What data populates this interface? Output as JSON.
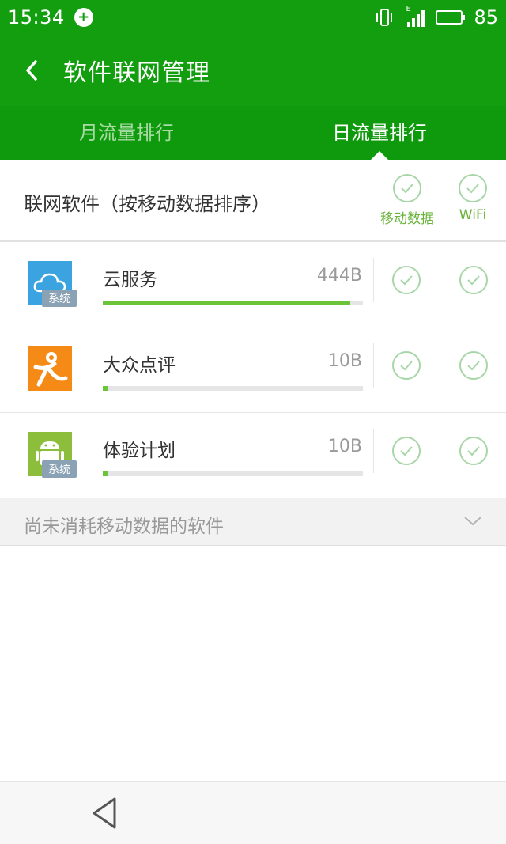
{
  "status_bar": {
    "time": "15:34",
    "app_notification_icon": "plus-circle-icon",
    "signal_label": "E",
    "battery_level": "85",
    "battery_fraction": 0.85
  },
  "app_bar": {
    "title": "软件联网管理",
    "back_icon": "chevron-left-icon"
  },
  "tabs": [
    {
      "label": "月流量排行",
      "active": false
    },
    {
      "label": "日流量排行",
      "active": true
    }
  ],
  "list_header": {
    "title": "联网软件（按移动数据排序）",
    "columns": [
      "移动数据",
      "WiFi"
    ]
  },
  "apps": [
    {
      "name": "云服务",
      "usage": "444B",
      "usage_fraction": 0.95,
      "badge": "系统",
      "icon": "cloud-icon",
      "mobile_enabled": true,
      "wifi_enabled": true
    },
    {
      "name": "大众点评",
      "usage": "10B",
      "usage_fraction": 0.02,
      "badge": "",
      "icon": "dianping-icon",
      "mobile_enabled": true,
      "wifi_enabled": true
    },
    {
      "name": "体验计划",
      "usage": "10B",
      "usage_fraction": 0.02,
      "badge": "系统",
      "icon": "android-icon",
      "mobile_enabled": true,
      "wifi_enabled": true
    }
  ],
  "section": {
    "label": "尚未消耗移动数据的软件",
    "icon": "chevron-down-icon"
  },
  "colors": {
    "primary": "#129e0f",
    "tab_bar": "#0e9a0c",
    "accent_green": "#69b33a",
    "progress": "#6cc438",
    "check_outline": "#a8d6a8"
  }
}
